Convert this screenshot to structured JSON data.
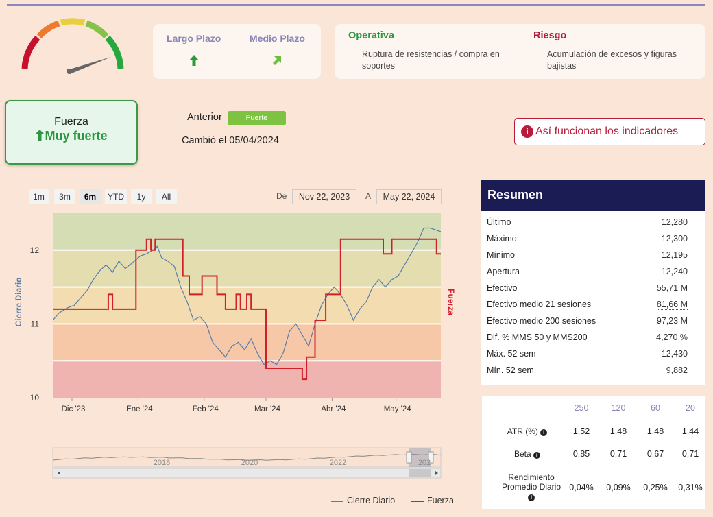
{
  "horizons": {
    "largo": {
      "label": "Largo Plazo",
      "arrow_icon": "arrow-up-icon",
      "color": "#2a9a3a"
    },
    "medio": {
      "label": "Medio Plazo",
      "arrow_icon": "arrow-up-right-icon",
      "color": "#6cbf3a"
    }
  },
  "operativa": {
    "title": "Operativa",
    "text": "Ruptura de resistencias / compra en soportes",
    "color": "#2d9640"
  },
  "riesgo": {
    "title": "Riesgo",
    "text": "Acumulación de excesos y figuras bajistas",
    "color": "#b01c3a"
  },
  "fuerza": {
    "title": "Fuerza",
    "value": "Muy fuerte"
  },
  "anterior": {
    "label": "Anterior",
    "badge": "Fuerte",
    "changed": "Cambió el 05/04/2024"
  },
  "info_button": {
    "label": "Así funcionan los indicadores",
    "icon": "info-icon"
  },
  "range_selector": {
    "buttons": [
      "1m",
      "3m",
      "6m",
      "YTD",
      "1y",
      "All"
    ],
    "active": "6m",
    "from_label": "De",
    "from_value": "Nov 22, 2023",
    "to_label": "A",
    "to_value": "May 22, 2024"
  },
  "summary": {
    "title": "Resumen",
    "rows": [
      {
        "label": "Último",
        "value": "12,280"
      },
      {
        "label": "Máximo",
        "value": "12,300"
      },
      {
        "label": "Mínimo",
        "value": "12,195"
      },
      {
        "label": "Apertura",
        "value": "12,240"
      },
      {
        "label": "Efectivo",
        "value": "55,71 M"
      },
      {
        "label": "Efectivo medio 21 sesiones",
        "value": "81,66 M"
      },
      {
        "label": "Efectivo medio 200 sesiones",
        "value": "97,23 M"
      },
      {
        "label": "Dif. % MMS 50 y MMS200",
        "value": "4,270 %"
      },
      {
        "label": "Máx. 52 sem",
        "value": "12,430"
      },
      {
        "label": "Mín. 52 sem",
        "value": "9,882"
      }
    ]
  },
  "stats": {
    "headers": [
      "250",
      "120",
      "60",
      "20"
    ],
    "rows": [
      {
        "label": "ATR (%)",
        "values": [
          "1,52",
          "1,48",
          "1,48",
          "1,44"
        ]
      },
      {
        "label": "Beta",
        "values": [
          "0,85",
          "0,71",
          "0,67",
          "0,71"
        ]
      },
      {
        "label": "Rendimiento Promedio Diario",
        "values": [
          "0,04%",
          "0,09%",
          "0,25%",
          "0,31%"
        ]
      }
    ]
  },
  "navigator": {
    "years": [
      "2018",
      "2020",
      "2022",
      "202"
    ]
  },
  "chart_data": {
    "type": "line",
    "xlabel": "",
    "ylabel": "Cierre Diario",
    "y2label": "Fuerza",
    "ylim": [
      10,
      12.5
    ],
    "yticks": [
      10,
      11,
      12
    ],
    "x_tick_labels": [
      "Dic '23",
      "Ene '24",
      "Feb '24",
      "Mar '24",
      "Abr '24",
      "May '24"
    ],
    "x_ticks_dates": [
      "2023-12-01",
      "2024-01-01",
      "2024-02-01",
      "2024-03-01",
      "2024-04-01",
      "2024-05-01"
    ],
    "x_range": [
      "2023-11-22",
      "2024-05-22"
    ],
    "bands": [
      {
        "from": 10.0,
        "to": 10.5,
        "color": "#f0b4b0"
      },
      {
        "from": 10.5,
        "to": 11.0,
        "color": "#f6c8a8"
      },
      {
        "from": 11.0,
        "to": 11.5,
        "color": "#f2dcb0"
      },
      {
        "from": 11.5,
        "to": 12.0,
        "color": "#e4ddb0"
      },
      {
        "from": 12.0,
        "to": 12.5,
        "color": "#d5ddb4"
      }
    ],
    "series": [
      {
        "name": "Cierre Diario",
        "color": "#5a7ca8",
        "points": [
          [
            "2023-11-22",
            11.05
          ],
          [
            "2023-11-25",
            11.15
          ],
          [
            "2023-11-29",
            11.22
          ],
          [
            "2023-12-02",
            11.25
          ],
          [
            "2023-12-05",
            11.35
          ],
          [
            "2023-12-08",
            11.45
          ],
          [
            "2023-12-11",
            11.6
          ],
          [
            "2023-12-14",
            11.72
          ],
          [
            "2023-12-17",
            11.8
          ],
          [
            "2023-12-20",
            11.7
          ],
          [
            "2023-12-23",
            11.85
          ],
          [
            "2023-12-26",
            11.75
          ],
          [
            "2023-12-29",
            11.82
          ],
          [
            "2024-01-02",
            11.92
          ],
          [
            "2024-01-05",
            11.95
          ],
          [
            "2024-01-08",
            12.0
          ],
          [
            "2024-01-10",
            12.05
          ],
          [
            "2024-01-12",
            11.9
          ],
          [
            "2024-01-15",
            11.85
          ],
          [
            "2024-01-18",
            11.78
          ],
          [
            "2024-01-21",
            11.5
          ],
          [
            "2024-01-24",
            11.3
          ],
          [
            "2024-01-27",
            11.05
          ],
          [
            "2024-01-30",
            11.1
          ],
          [
            "2024-02-02",
            11.0
          ],
          [
            "2024-02-05",
            10.75
          ],
          [
            "2024-02-08",
            10.65
          ],
          [
            "2024-02-11",
            10.55
          ],
          [
            "2024-02-14",
            10.7
          ],
          [
            "2024-02-17",
            10.75
          ],
          [
            "2024-02-20",
            10.65
          ],
          [
            "2024-02-23",
            10.8
          ],
          [
            "2024-02-26",
            10.6
          ],
          [
            "2024-02-29",
            10.45
          ],
          [
            "2024-03-03",
            10.5
          ],
          [
            "2024-03-06",
            10.45
          ],
          [
            "2024-03-09",
            10.6
          ],
          [
            "2024-03-12",
            10.9
          ],
          [
            "2024-03-15",
            11.0
          ],
          [
            "2024-03-18",
            10.85
          ],
          [
            "2024-03-21",
            10.7
          ],
          [
            "2024-03-24",
            11.0
          ],
          [
            "2024-03-27",
            11.25
          ],
          [
            "2024-03-30",
            11.4
          ],
          [
            "2024-04-02",
            11.5
          ],
          [
            "2024-04-05",
            11.4
          ],
          [
            "2024-04-08",
            11.25
          ],
          [
            "2024-04-11",
            11.05
          ],
          [
            "2024-04-14",
            11.2
          ],
          [
            "2024-04-17",
            11.3
          ],
          [
            "2024-04-20",
            11.5
          ],
          [
            "2024-04-23",
            11.6
          ],
          [
            "2024-04-26",
            11.5
          ],
          [
            "2024-04-29",
            11.6
          ],
          [
            "2024-05-02",
            11.65
          ],
          [
            "2024-05-05",
            11.8
          ],
          [
            "2024-05-08",
            11.95
          ],
          [
            "2024-05-11",
            12.1
          ],
          [
            "2024-05-14",
            12.3
          ],
          [
            "2024-05-17",
            12.3
          ],
          [
            "2024-05-22",
            12.25
          ]
        ]
      },
      {
        "name": "Fuerza",
        "color": "#d0202a",
        "points": [
          [
            "2023-11-22",
            11.2
          ],
          [
            "2023-12-18",
            11.2
          ],
          [
            "2023-12-18",
            11.4
          ],
          [
            "2023-12-20",
            11.4
          ],
          [
            "2023-12-20",
            11.2
          ],
          [
            "2023-12-31",
            11.2
          ],
          [
            "2023-12-31",
            12.0
          ],
          [
            "2024-01-05",
            12.0
          ],
          [
            "2024-01-05",
            12.15
          ],
          [
            "2024-01-07",
            12.15
          ],
          [
            "2024-01-07",
            12.0
          ],
          [
            "2024-01-09",
            12.0
          ],
          [
            "2024-01-09",
            12.15
          ],
          [
            "2024-01-22",
            12.15
          ],
          [
            "2024-01-22",
            11.65
          ],
          [
            "2024-01-25",
            11.65
          ],
          [
            "2024-01-25",
            11.4
          ],
          [
            "2024-01-31",
            11.4
          ],
          [
            "2024-01-31",
            11.65
          ],
          [
            "2024-02-07",
            11.65
          ],
          [
            "2024-02-07",
            11.4
          ],
          [
            "2024-02-11",
            11.4
          ],
          [
            "2024-02-11",
            11.2
          ],
          [
            "2024-02-16",
            11.2
          ],
          [
            "2024-02-16",
            11.4
          ],
          [
            "2024-02-18",
            11.4
          ],
          [
            "2024-02-18",
            11.2
          ],
          [
            "2024-02-21",
            11.2
          ],
          [
            "2024-02-21",
            11.4
          ],
          [
            "2024-02-23",
            11.4
          ],
          [
            "2024-02-23",
            11.2
          ],
          [
            "2024-03-01",
            11.2
          ],
          [
            "2024-03-01",
            10.4
          ],
          [
            "2024-03-18",
            10.4
          ],
          [
            "2024-03-18",
            10.25
          ],
          [
            "2024-03-20",
            10.25
          ],
          [
            "2024-03-20",
            10.55
          ],
          [
            "2024-03-24",
            10.55
          ],
          [
            "2024-03-24",
            11.05
          ],
          [
            "2024-03-29",
            11.05
          ],
          [
            "2024-03-29",
            11.4
          ],
          [
            "2024-04-05",
            11.4
          ],
          [
            "2024-04-05",
            12.15
          ],
          [
            "2024-04-25",
            12.15
          ],
          [
            "2024-04-25",
            11.95
          ],
          [
            "2024-04-29",
            11.95
          ],
          [
            "2024-04-29",
            12.15
          ],
          [
            "2024-05-20",
            12.15
          ],
          [
            "2024-05-20",
            11.95
          ],
          [
            "2024-05-22",
            11.95
          ]
        ]
      }
    ],
    "legend": [
      "Cierre Diario",
      "Fuerza"
    ]
  }
}
